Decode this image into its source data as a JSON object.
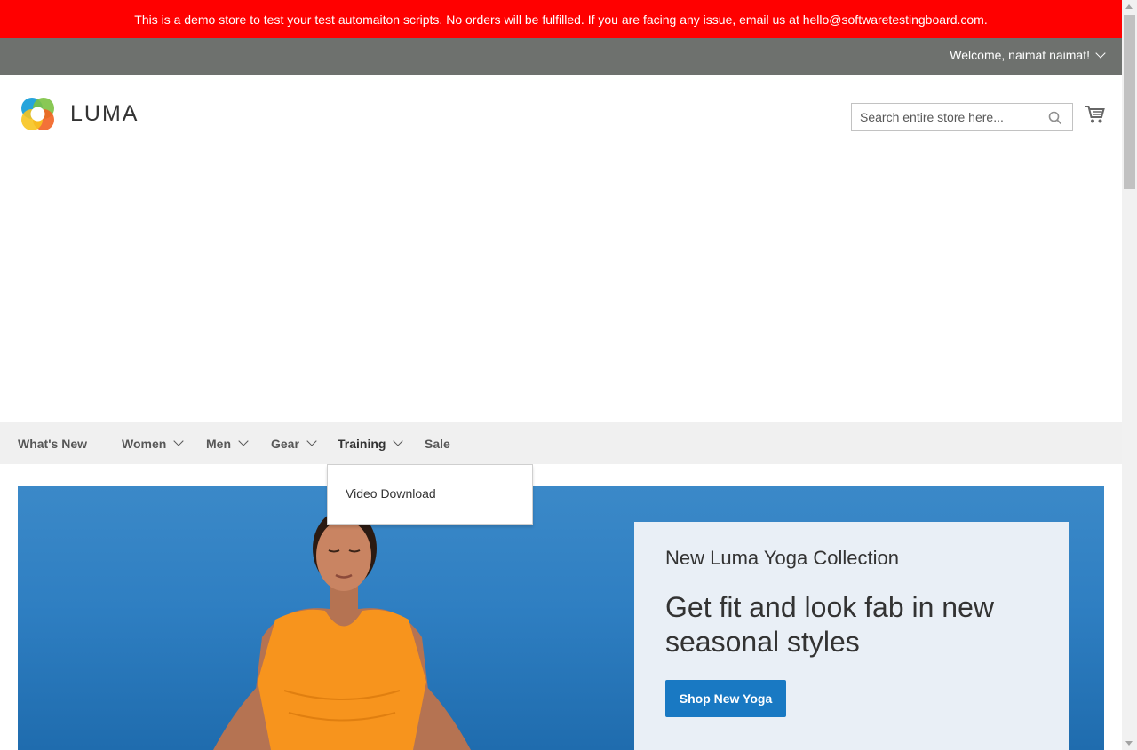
{
  "demo_notice": "This is a demo store to test your test automaiton scripts. No orders will be fulfilled. If you are facing any issue, email us at hello@softwaretestingboard.com.",
  "header": {
    "welcome": "Welcome, naimat naimat!",
    "logo_text": "LUMA",
    "search_placeholder": "Search entire store here...",
    "search_value": ""
  },
  "nav": {
    "items": [
      {
        "label": "What's New",
        "has_dropdown": false
      },
      {
        "label": "Women",
        "has_dropdown": true
      },
      {
        "label": "Men",
        "has_dropdown": true
      },
      {
        "label": "Gear",
        "has_dropdown": true
      },
      {
        "label": "Training",
        "has_dropdown": true,
        "active": true
      },
      {
        "label": "Sale",
        "has_dropdown": false
      }
    ],
    "training_menu": [
      "Video Download"
    ]
  },
  "hero": {
    "kicker": "New Luma Yoga Collection",
    "title": "Get fit and look fab in new seasonal styles",
    "button": "Shop New Yoga"
  },
  "colors": {
    "demo_bar": "#ff0000",
    "top_bar": "#6e716e",
    "nav_bg": "#f0f0f0",
    "button": "#1979c3",
    "promo_bg": "#e9eff6"
  },
  "icons": [
    "chevron-down-icon",
    "search-icon",
    "cart-icon",
    "luma-logo-icon"
  ]
}
